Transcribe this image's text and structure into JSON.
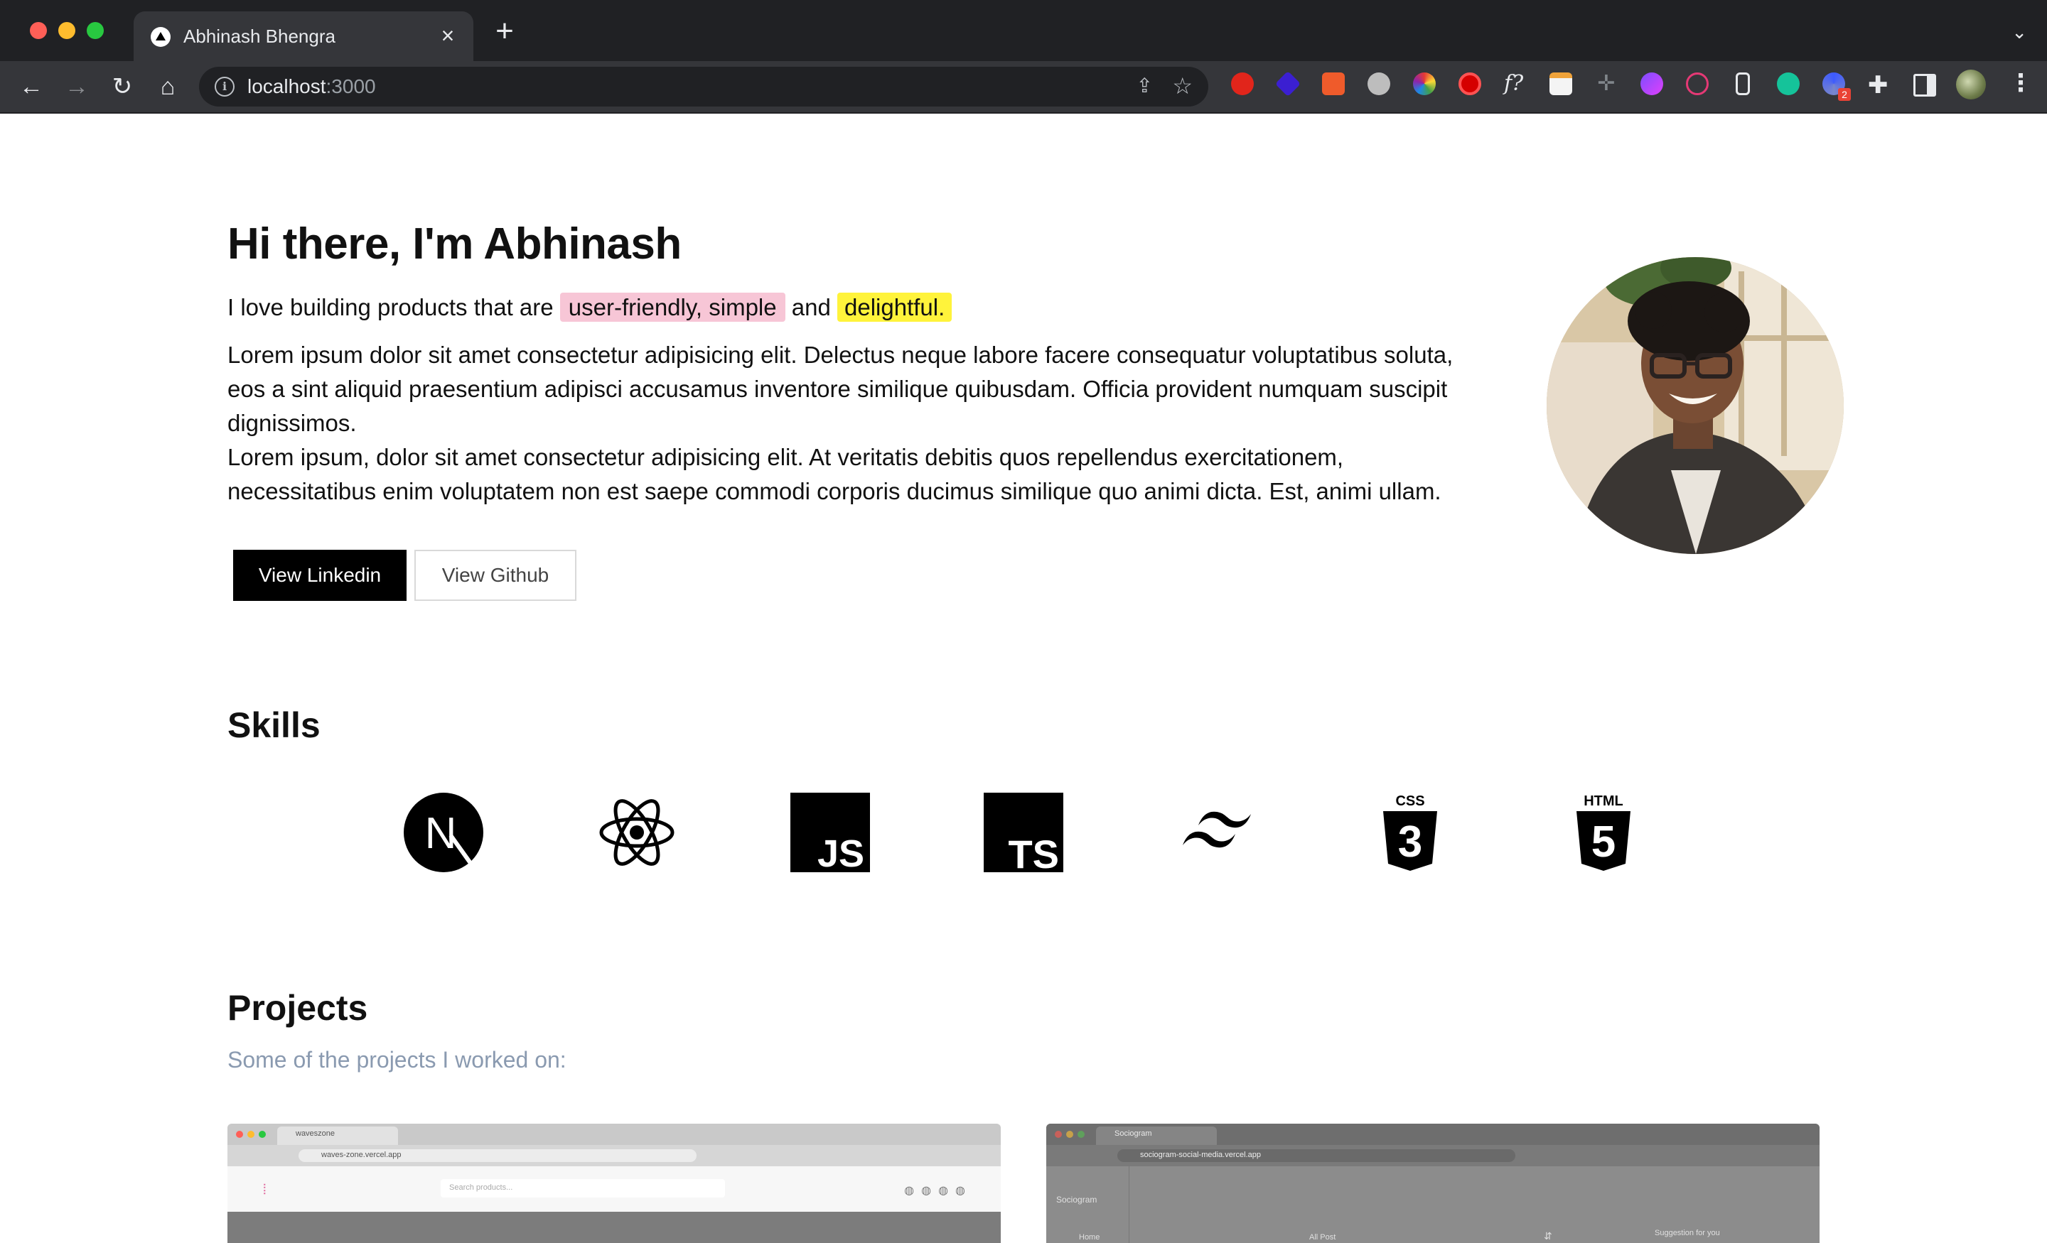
{
  "browser": {
    "tab_title": "Abhinash Bhengra",
    "url_host": "localhost",
    "url_port": ":3000",
    "extension_badge": "2"
  },
  "hero": {
    "heading": "Hi there, I'm Abhinash",
    "tagline_prefix": "I love building products that are ",
    "tagline_highlight1": "user-friendly, simple",
    "tagline_and": " and ",
    "tagline_highlight2": "delightful",
    "tagline_suffix": ".",
    "bio_paragraph_1": "Lorem ipsum dolor sit amet consectetur adipisicing elit. Delectus neque labore facere consequatur voluptatibus soluta, eos a sint aliquid praesentium adipisci accusamus inventore similique quibusdam. Officia provident numquam suscipit dignissimos.",
    "bio_paragraph_2": "Lorem ipsum, dolor sit amet consectetur adipisicing elit. At veritatis debitis quos repellendus exercitationem, necessitatibus enim voluptatem non est saepe commodi corporis ducimus similique quo animi dicta. Est, animi ullam.",
    "linkedin_label": "View Linkedin",
    "github_label": "View Github",
    "highlight_pink": "#f7c6d6",
    "highlight_yellow": "#fff33b"
  },
  "skills": {
    "title": "Skills",
    "items": [
      {
        "name": "nextjs-icon",
        "label": "N"
      },
      {
        "name": "react-icon",
        "label": ""
      },
      {
        "name": "javascript-icon",
        "label": "JS"
      },
      {
        "name": "typescript-icon",
        "label": "TS"
      },
      {
        "name": "tailwind-icon",
        "label": ""
      },
      {
        "name": "css3-icon",
        "label": "CSS",
        "number": "3"
      },
      {
        "name": "html5-icon",
        "label": "HTML",
        "number": "5"
      }
    ]
  },
  "projects": {
    "title": "Projects",
    "subtitle": "Some of the projects I worked on:",
    "cards": [
      {
        "tab": "waveszone",
        "url": "waves-zone.vercel.app",
        "search_placeholder": "Search products..."
      },
      {
        "tab": "Sociogram",
        "url": "sociogram-social-media.vercel.app",
        "brand": "Sociogram",
        "nav_home": "Home",
        "feed_title": "All Post",
        "suggestion_title": "Suggestion for you"
      }
    ]
  }
}
